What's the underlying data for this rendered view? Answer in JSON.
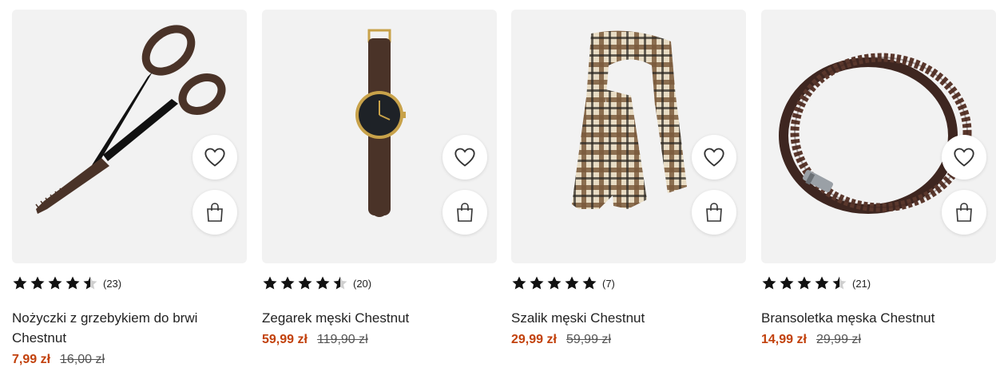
{
  "colors": {
    "price_accent": "#c2410c",
    "card_bg": "#f2f2f2",
    "star": "#111111",
    "star_empty": "#d0d0d0"
  },
  "products": [
    {
      "title": "Nożyczki z grzebykiem do brwi Chestnut",
      "rating": 4.5,
      "reviews": "(23)",
      "price": "7,99 zł",
      "old_price": "16,00 zł",
      "image_icon": "eyebrow-scissors-image"
    },
    {
      "title": "Zegarek męski Chestnut",
      "rating": 4.5,
      "reviews": "(20)",
      "price": "59,99 zł",
      "old_price": "119,90 zł",
      "image_icon": "wristwatch-image"
    },
    {
      "title": "Szalik męski Chestnut",
      "rating": 5,
      "reviews": "(7)",
      "price": "29,99 zł",
      "old_price": "59,99 zł",
      "image_icon": "plaid-scarf-image"
    },
    {
      "title": "Bransoletka męska Chestnut",
      "rating": 4.5,
      "reviews": "(21)",
      "price": "14,99 zł",
      "old_price": "29,99 zł",
      "image_icon": "leather-bracelet-image"
    }
  ],
  "buttons": {
    "wishlist_icon": "heart-icon",
    "cart_icon": "shopping-bag-icon"
  }
}
